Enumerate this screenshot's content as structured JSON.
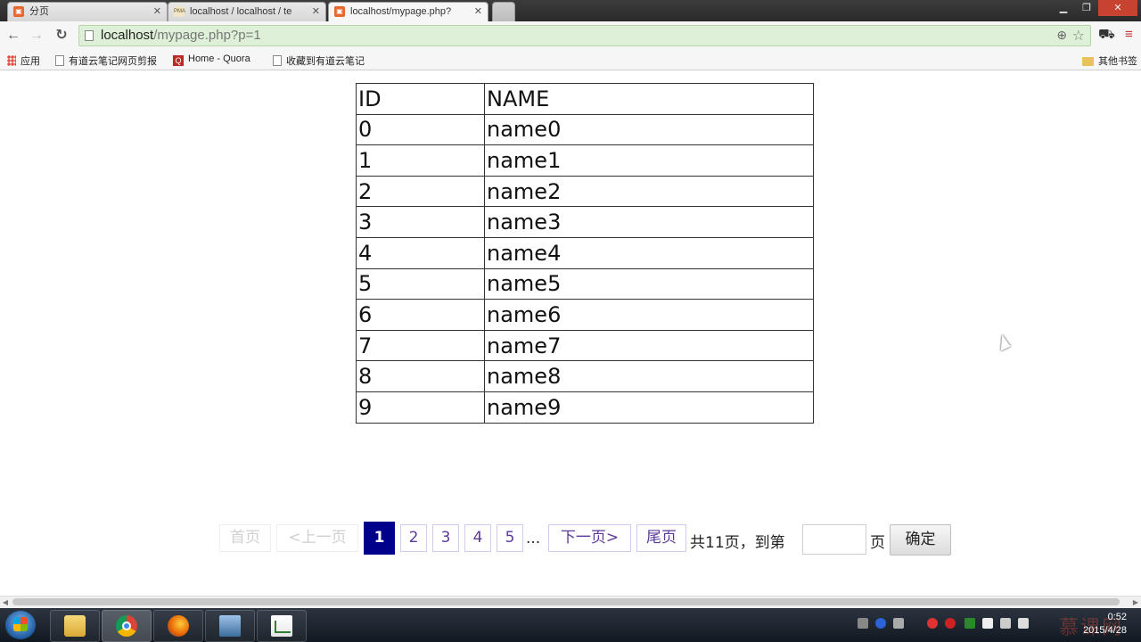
{
  "browser": {
    "tabs": [
      {
        "title": "分页",
        "icon": "html-page-icon",
        "active": false
      },
      {
        "title": "localhost / localhost / te",
        "icon": "phpmyadmin-icon",
        "active": false
      },
      {
        "title": "localhost/mypage.php?",
        "icon": "html-page-icon",
        "active": true
      }
    ],
    "url_host": "localhost",
    "url_path": "/mypage.php?p=1",
    "bookmarks": [
      {
        "label": "应用",
        "icon": "apps-grid-icon"
      },
      {
        "label": "有道云笔记网页剪报",
        "icon": "page-icon"
      },
      {
        "label": "Home - Quora",
        "icon": "quora-icon"
      },
      {
        "label": "收藏到有道云笔记",
        "icon": "page-icon"
      }
    ],
    "other_bookmarks": "其他书签",
    "icons": {
      "back": "←",
      "forward": "→",
      "reload": "↻",
      "menu": "≡",
      "zoom": "⊕",
      "star": "☆",
      "close": "✕"
    }
  },
  "table": {
    "headers": [
      "ID",
      "NAME"
    ],
    "rows": [
      [
        "0",
        "name0"
      ],
      [
        "1",
        "name1"
      ],
      [
        "2",
        "name2"
      ],
      [
        "3",
        "name3"
      ],
      [
        "4",
        "name4"
      ],
      [
        "5",
        "name5"
      ],
      [
        "6",
        "name6"
      ],
      [
        "7",
        "name7"
      ],
      [
        "8",
        "name8"
      ],
      [
        "9",
        "name9"
      ]
    ]
  },
  "pager": {
    "first": "首页",
    "prev": "<上一页",
    "current": "1",
    "pages": [
      "2",
      "3",
      "4",
      "5"
    ],
    "ellipsis": "...",
    "next": "下一页>",
    "last": "尾页",
    "total_prefix": "共",
    "total_pages": "11",
    "total_suffix": "页，到第",
    "page_unit": "页",
    "jump_value": "",
    "confirm": "确定"
  },
  "taskbar": {
    "apps": [
      "explorer",
      "chrome",
      "firefox",
      "remote-desktop",
      "chart-app"
    ],
    "clock_time": "0:52",
    "clock_date": "2015/4/28",
    "watermark": "慕课网"
  },
  "colors": {
    "current_page_bg": "#00008b",
    "link": "#5b3a9a",
    "url_bg": "#dff0d8"
  }
}
